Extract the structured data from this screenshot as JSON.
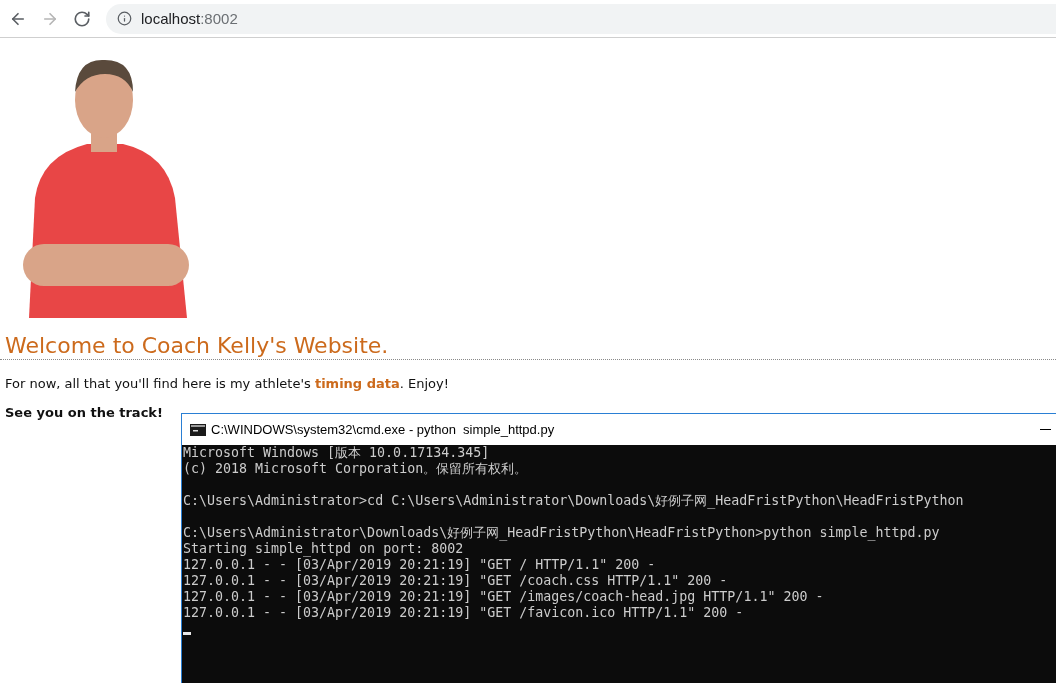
{
  "browser": {
    "nav_buttons": [
      {
        "kind": "back",
        "disabled": false
      },
      {
        "kind": "forward",
        "disabled": true
      },
      {
        "kind": "reload",
        "disabled": false
      }
    ],
    "address": {
      "host": "localhost",
      "port": ":8002"
    }
  },
  "page": {
    "heading": "Welcome to Coach Kelly's Website.",
    "intro": "For now, all that you'll find here is my athlete's **timing data**. Enjoy!",
    "signoff": "See you on the track!"
  },
  "console_window": {
    "title": "C:\\WINDOWS\\system32\\cmd.exe - python  simple_httpd.py",
    "blocks": [
      [
        "Microsoft Windows [版本 10.0.17134.345]",
        "(c) 2018 Microsoft Corporation。保留所有权利。"
      ],
      [
        "C:\\Users\\Administrator>cd C:\\Users\\Administrator\\Downloads\\好例子网_HeadFristPython\\HeadFristPython"
      ],
      [
        "C:\\Users\\Administrator\\Downloads\\好例子网_HeadFristPython\\HeadFristPython>python simple_httpd.py",
        "Starting simple_httpd on port: 8002",
        "127.0.0.1 - - [03/Apr/2019 20:21:19] \"GET / HTTP/1.1\" 200 -",
        "127.0.0.1 - - [03/Apr/2019 20:21:19] \"GET /coach.css HTTP/1.1\" 200 -",
        "127.0.0.1 - - [03/Apr/2019 20:21:19] \"GET /images/coach-head.jpg HTTP/1.1\" 200 -",
        "127.0.0.1 - - [03/Apr/2019 20:21:19] \"GET /favicon.ico HTTP/1.1\" 200 -"
      ]
    ],
    "cursor": true
  }
}
